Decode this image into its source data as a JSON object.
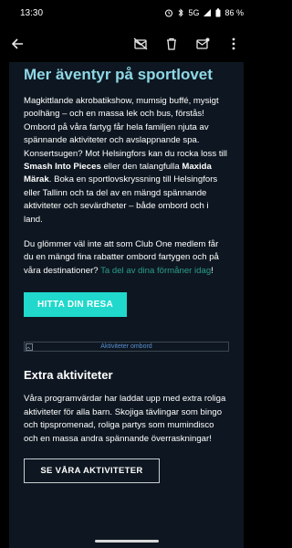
{
  "status_bar": {
    "time": "13:30",
    "network": "5G",
    "battery": "86 %"
  },
  "toolbar": {
    "icons": [
      "arrow-back-icon",
      "mark-unread-icon",
      "delete-icon",
      "move-to-inbox-icon",
      "more-vert-icon"
    ]
  },
  "email": {
    "headline": "Mer äventyr på sportlovet",
    "p1": {
      "t1": "Magkittlande akrobatikshow, mumsig buffé, mysigt poolhäng – och en massa lek och bus, förstås! Ombord på våra fartyg får hela familjen njuta av spännande aktiviteter och avslappnande spa. Konsertsugen? Mot Helsingfors kan du rocka loss till ",
      "b1": "Smash Into Pieces",
      "t2": " eller den talangfulla ",
      "b2": "Maxida Märak",
      "t3": ". Boka en sportlovskryssning till Helsingfors eller Tallinn och ta del av en mängd spännande aktiviteter och sevärdheter – både ombord och i land."
    },
    "p2": {
      "t1": "Du glömmer väl inte att som Club One medlem får du en mängd fina rabatter ombord fartygen och på våra destinationer? ",
      "link": "Ta del av dina förmåner idag",
      "t2": "!"
    },
    "cta_primary": "HITTA DIN RESA",
    "image_alt": "Aktiviteter ombord",
    "subhead": "Extra aktiviteter",
    "p3": "Våra programvärdar har laddat upp med extra roliga aktiviteter för alla barn. Skojiga tävlingar som bingo och tipspromenad, roliga partys som mumindisco och en massa andra spännande överraskningar!",
    "cta_secondary": "SE VÅRA AKTIVITETER"
  },
  "colors": {
    "background": "#000000",
    "content_bg": "#0e1721",
    "headline": "#8fd8e6",
    "cta_primary": "#20d8cc",
    "link": "#2a9d8f"
  }
}
